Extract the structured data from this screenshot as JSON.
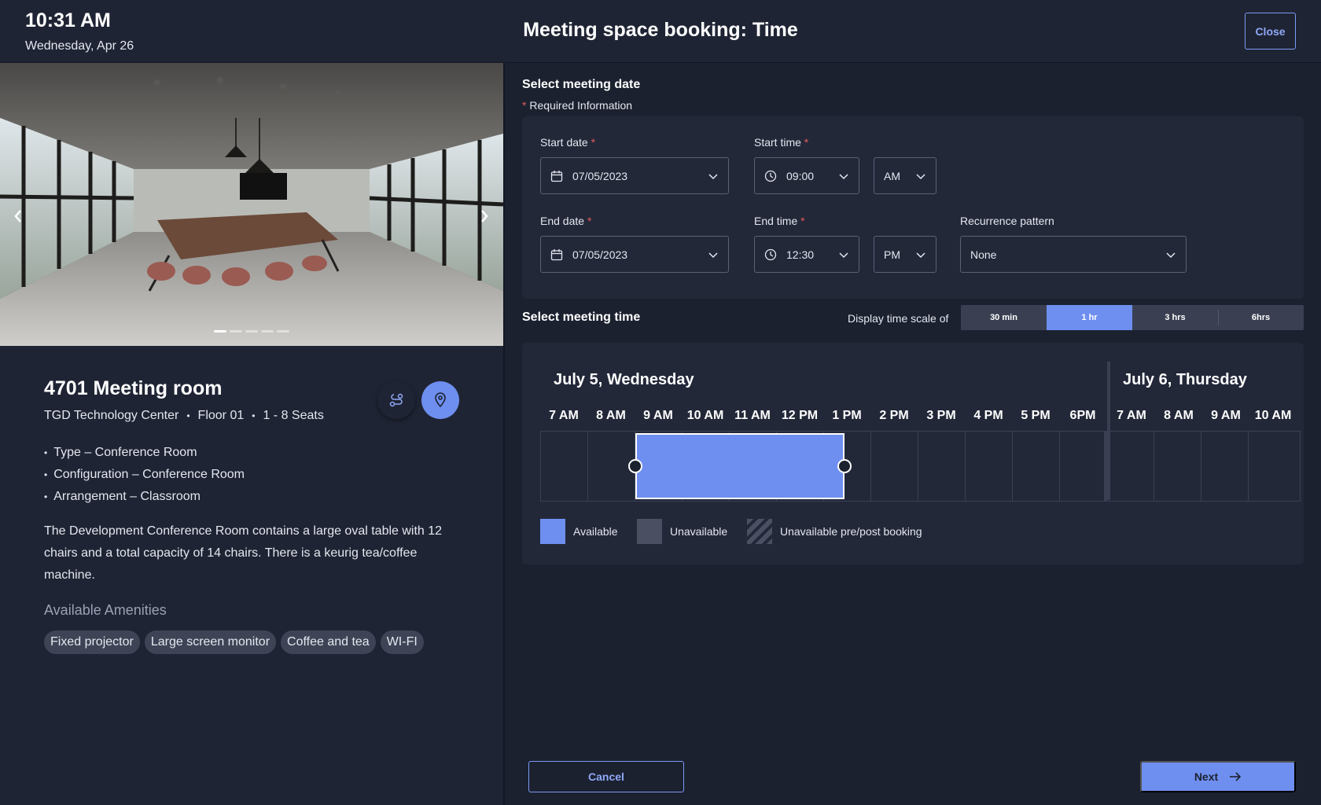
{
  "header": {
    "time": "10:31 AM",
    "date": "Wednesday, Apr 26",
    "title": "Meeting space booking: Time",
    "close_label": "Close"
  },
  "room": {
    "name": "4701 Meeting room",
    "meta": [
      "TGD Technology Center",
      "Floor 01",
      "1 - 8 Seats"
    ],
    "meta_sep": "•",
    "details": [
      "Type – Conference Room",
      "Configuration – Conference Room",
      "Arrangement – Classroom"
    ],
    "description": "The Development Conference Room contains a large oval table with 12 chairs and a total capacity of 14 chairs.  There is a keurig tea/coffee machine.",
    "amenities_title": "Available Amenities",
    "amenities": [
      "Fixed projector",
      "Large screen monitor",
      "Coffee and tea",
      "WI-FI"
    ],
    "carousel": {
      "slide_count": 5,
      "active_index": 0
    }
  },
  "date_section": {
    "title": "Select meeting date",
    "required_mark": "*",
    "required_text": "Required Information",
    "start_date_label": "Start date",
    "start_date": "07/05/2023",
    "start_time_label": "Start time",
    "start_time": "09:00",
    "start_ampm": "AM",
    "end_date_label": "End date",
    "end_date": "07/05/2023",
    "end_time_label": "End time",
    "end_time": "12:30",
    "end_ampm": "PM",
    "recurrence_label": "Recurrence pattern",
    "recurrence": "None"
  },
  "time_section": {
    "title": "Select meeting time",
    "scale_label": "Display time scale of",
    "scale_options": [
      "30 min",
      "1 hr",
      "3 hrs",
      "6hrs"
    ],
    "scale_active": "1 hr",
    "day1": "July 5, Wednesday",
    "day2": "July 6, Thursday",
    "hours": [
      "7 AM",
      "8 AM",
      "9 AM",
      "10 AM",
      "11 AM",
      "12 PM",
      "1 PM",
      "2 PM",
      "3 PM",
      "4 PM",
      "5 PM",
      "6PM",
      "7 AM",
      "8 AM",
      "9 AM",
      "10 AM"
    ],
    "selection": {
      "start": "9:00 AM",
      "end": "12:30 PM"
    },
    "legend": [
      "Available",
      "Unavailable",
      "Unavailable pre/post booking"
    ]
  },
  "footer": {
    "cancel_label": "Cancel",
    "next_label": "Next"
  },
  "colors": {
    "accent": "#6e8ff0",
    "background": "#1c2130",
    "panel": "#232839",
    "unavailable": "#4a5062"
  }
}
